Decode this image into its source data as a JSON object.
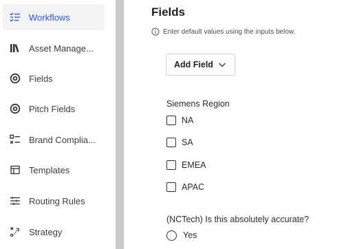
{
  "sidebar": {
    "items": [
      {
        "label": "Workflows",
        "icon": "workflows-icon",
        "active": true
      },
      {
        "label": "Asset Manage...",
        "icon": "library-icon",
        "active": false
      },
      {
        "label": "Fields",
        "icon": "target-icon",
        "active": false
      },
      {
        "label": "Pitch Fields",
        "icon": "target-icon",
        "active": false
      },
      {
        "label": "Brand Complia...",
        "icon": "checklist-icon",
        "active": false
      },
      {
        "label": "Templates",
        "icon": "template-icon",
        "active": false
      },
      {
        "label": "Routing Rules",
        "icon": "sliders-icon",
        "active": false
      },
      {
        "label": "Strategy",
        "icon": "strategy-icon",
        "active": false
      }
    ]
  },
  "main": {
    "title": "Fields",
    "hint": "Enter default values using the inputs below.",
    "add_field_label": "Add Field",
    "region": {
      "label": "Siemens Region",
      "options": [
        "NA",
        "SA",
        "EMEA",
        "APAC"
      ]
    },
    "accuracy": {
      "label": "(NCTech) Is this absolutely accurate?",
      "options": [
        "Yes"
      ]
    }
  },
  "colors": {
    "accent": "#2f54eb",
    "active_bg": "#f1f3f5",
    "divider": "#c9c9c9"
  }
}
